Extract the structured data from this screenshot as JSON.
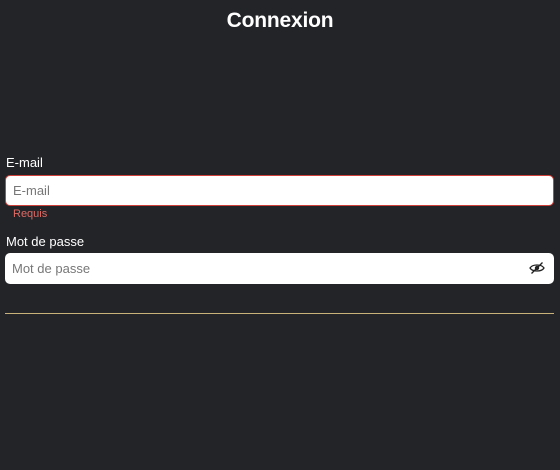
{
  "page": {
    "title": "Connexion"
  },
  "form": {
    "email": {
      "label": "E-mail",
      "placeholder": "E-mail",
      "value": "",
      "error": "Requis"
    },
    "password": {
      "label": "Mot de passe",
      "placeholder": "Mot de passe",
      "value": "",
      "toggle_icon": "eye-icon"
    }
  },
  "colors": {
    "background": "#232428",
    "error": "#e06a64",
    "error_border": "#d0403a",
    "divider": "#c8b27a"
  }
}
